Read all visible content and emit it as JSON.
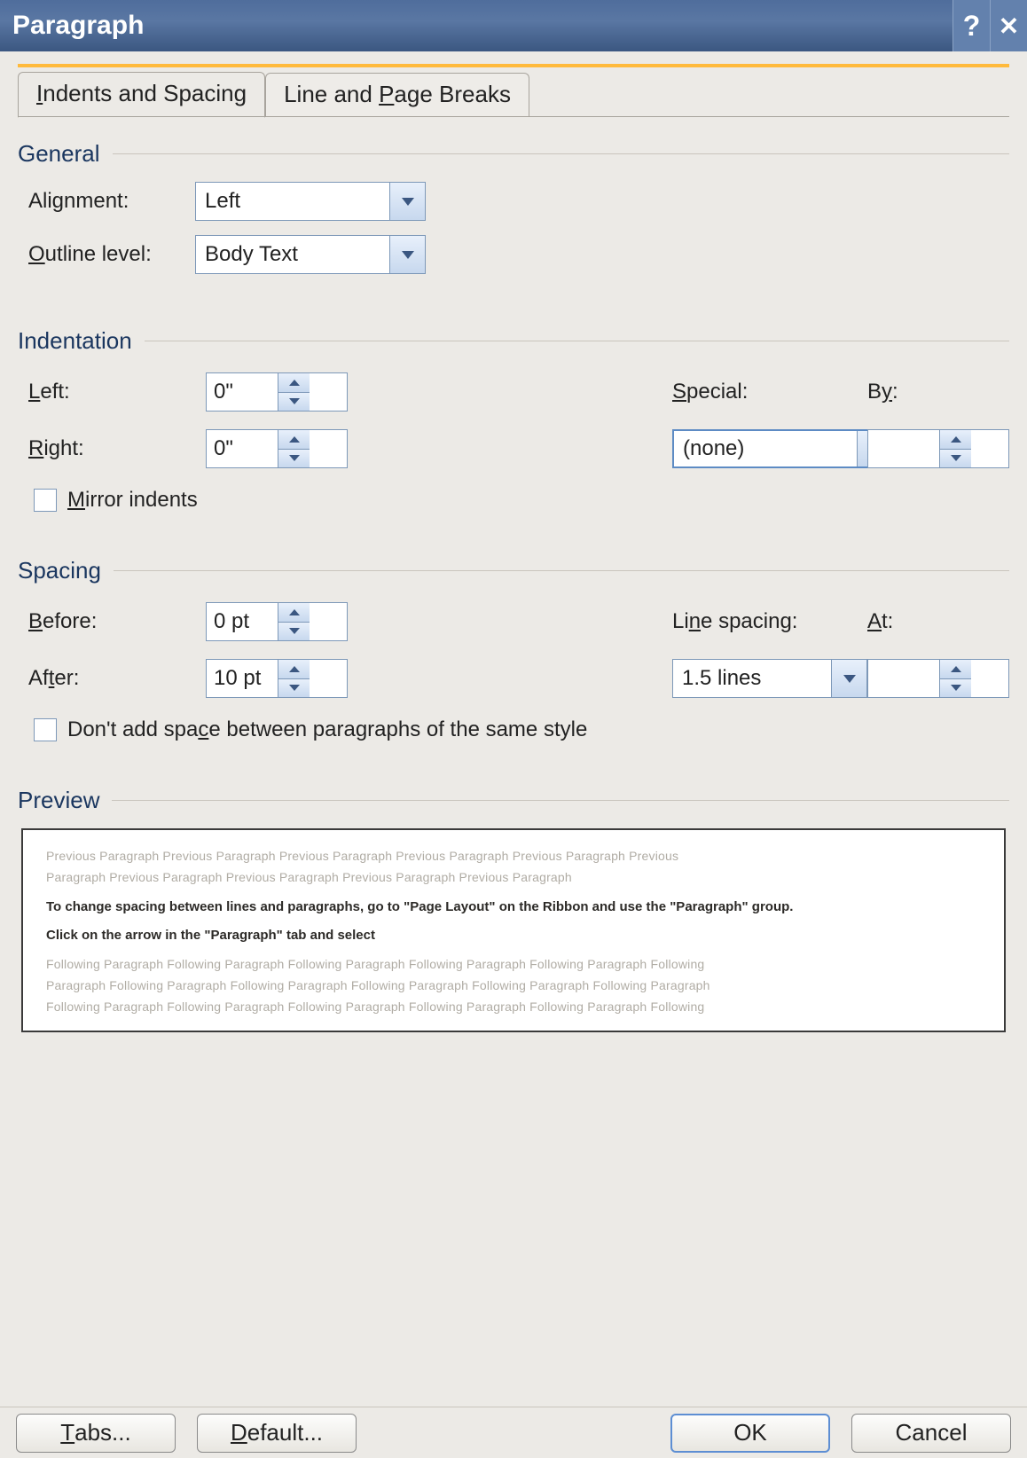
{
  "title": "Paragraph",
  "tabs": {
    "indents": "Indents and Spacing",
    "linebreaks": "Line and Page Breaks"
  },
  "sections": {
    "general": "General",
    "indentation": "Indentation",
    "spacing": "Spacing",
    "preview": "Preview"
  },
  "general": {
    "alignment_label": "Alignment:",
    "alignment_value": "Left",
    "outline_label_pre": "O",
    "outline_label_post": "utline level:",
    "outline_value": "Body Text"
  },
  "indentation": {
    "left_label_pre": "L",
    "left_label_post": "eft:",
    "left_value": "0\"",
    "right_label_pre": "R",
    "right_label_post": "ight:",
    "right_value": "0\"",
    "special_label_pre": "S",
    "special_label_post": "pecial:",
    "special_value": "(none)",
    "by_label_pre": "B",
    "by_label_post": "y:",
    "by_value": "",
    "mirror_label_pre": "M",
    "mirror_label_post": "irror indents"
  },
  "spacing": {
    "before_label_pre": "B",
    "before_label_post": "efore:",
    "before_value": "0 pt",
    "after_label_pre": "Af",
    "after_label_post": "t",
    "after_label_post2": "er:",
    "after_value": "10 pt",
    "linespacing_label_pre": "Li",
    "linespacing_label_post": "n",
    "linespacing_label_post2": "e spacing:",
    "linespacing_value": "1.5 lines",
    "at_label_pre": "A",
    "at_label_post": "t:",
    "at_value": "",
    "dontadd_pre": "Don't add spa",
    "dontadd_u": "c",
    "dontadd_post": "e between paragraphs of the same style"
  },
  "preview": {
    "faded1": "Previous Paragraph Previous Paragraph Previous Paragraph Previous Paragraph Previous Paragraph Previous",
    "faded2": "Paragraph Previous Paragraph Previous Paragraph Previous Paragraph Previous Paragraph",
    "bold1": "To change spacing between lines and paragraphs, go to \"Page Layout\" on the Ribbon and use the \"Paragraph\" group.",
    "bold2": "Click on the arrow in the \"Paragraph\" tab and select",
    "faded3": "Following Paragraph Following Paragraph Following Paragraph Following Paragraph Following Paragraph Following",
    "faded4": "Paragraph Following Paragraph Following Paragraph Following Paragraph Following Paragraph Following Paragraph",
    "faded5": "Following Paragraph Following Paragraph Following Paragraph Following Paragraph Following Paragraph Following"
  },
  "footer": {
    "tabs_pre": "T",
    "tabs_post": "abs...",
    "default_pre": "D",
    "default_post": "efault...",
    "ok": "OK",
    "cancel": "Cancel"
  }
}
